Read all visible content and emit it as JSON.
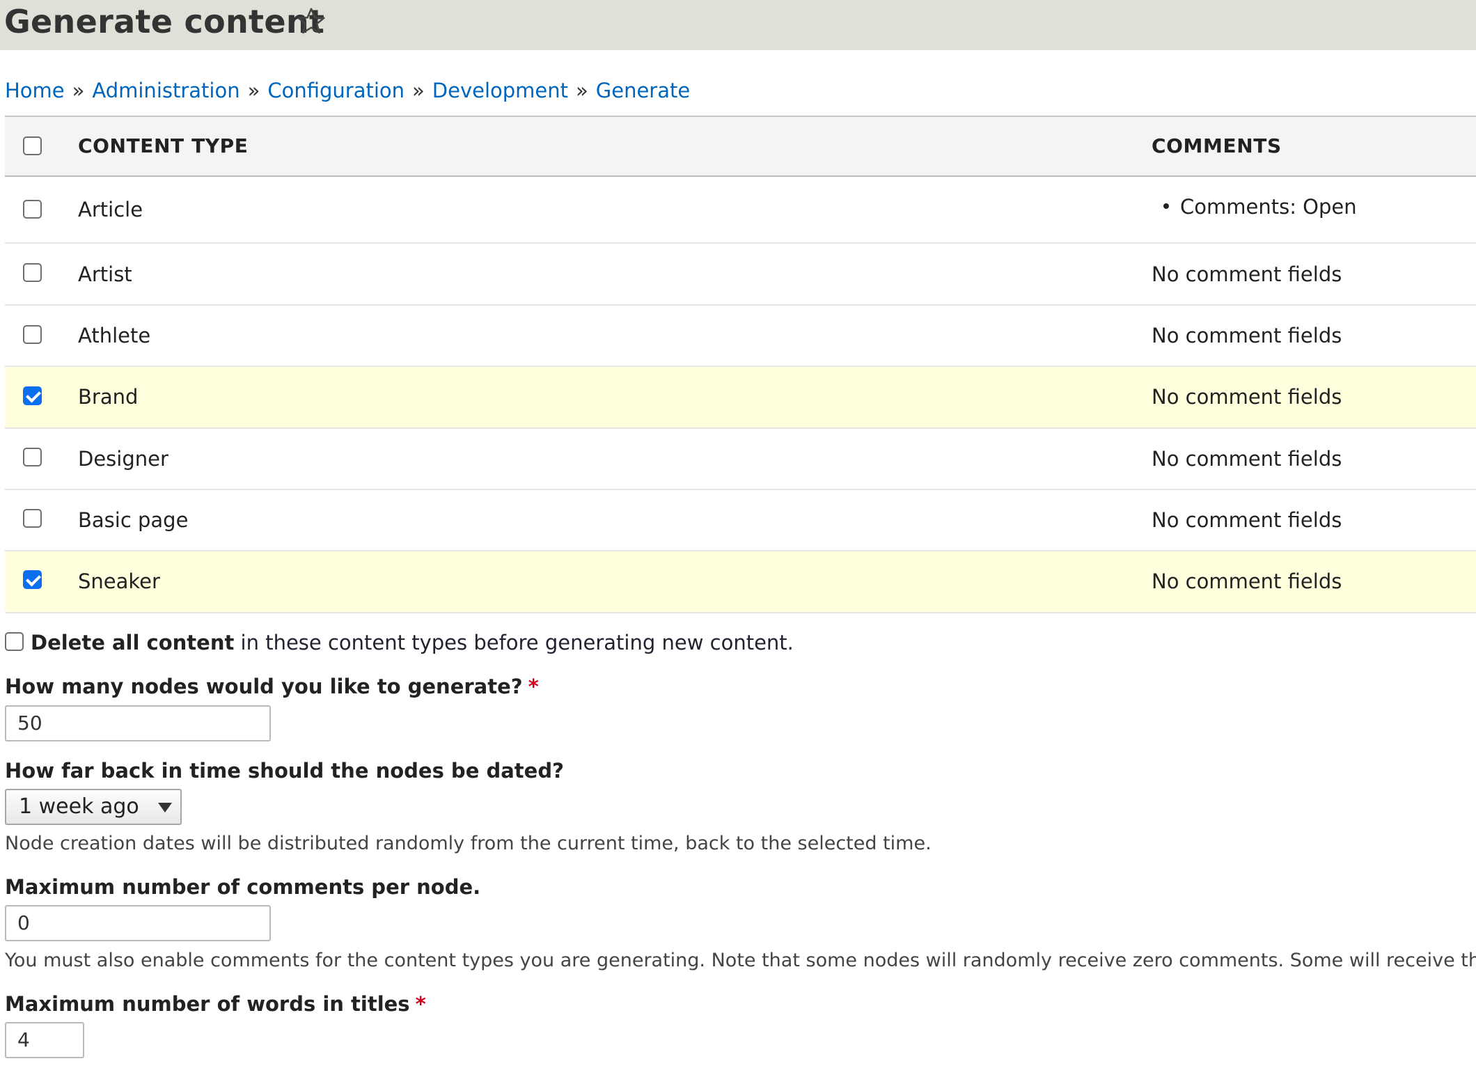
{
  "header": {
    "title": "Generate content"
  },
  "breadcrumb": [
    {
      "label": "Home"
    },
    {
      "label": "Administration"
    },
    {
      "label": "Configuration"
    },
    {
      "label": "Development"
    },
    {
      "label": "Generate"
    }
  ],
  "breadcrumb_separator": "»",
  "table": {
    "headers": {
      "content_type": "CONTENT TYPE",
      "comments": "COMMENTS"
    },
    "rows": [
      {
        "type": "Article",
        "comments": "Comments: Open",
        "bullet": true,
        "checked": false
      },
      {
        "type": "Artist",
        "comments": "No comment fields",
        "checked": false
      },
      {
        "type": "Athlete",
        "comments": "No comment fields",
        "checked": false
      },
      {
        "type": "Brand",
        "comments": "No comment fields",
        "checked": true
      },
      {
        "type": "Designer",
        "comments": "No comment fields",
        "checked": false
      },
      {
        "type": "Basic page",
        "comments": "No comment fields",
        "checked": false
      },
      {
        "type": "Sneaker",
        "comments": "No comment fields",
        "checked": true
      }
    ]
  },
  "delete_option": {
    "strong": "Delete all content",
    "rest": " in these content types before generating new content.",
    "checked": false
  },
  "fields": {
    "num_nodes": {
      "label": "How many nodes would you like to generate?",
      "required": "*",
      "value": "50"
    },
    "time_range": {
      "label": "How far back in time should the nodes be dated?",
      "selected": "1 week ago",
      "description": "Node creation dates will be distributed randomly from the current time, back to the selected time."
    },
    "max_comments": {
      "label": "Maximum number of comments per node.",
      "value": "0",
      "description": "You must also enable comments for the content types you are generating. Note that some nodes will randomly receive zero comments. Some will receive the max."
    },
    "title_words": {
      "label": "Maximum number of words in titles",
      "required": "*",
      "value": "4"
    }
  },
  "colors": {
    "link": "#0066bd",
    "selected_row": "#ffffdd",
    "checkbox_checked": "#0b6ff0",
    "required": "#d0021b"
  }
}
